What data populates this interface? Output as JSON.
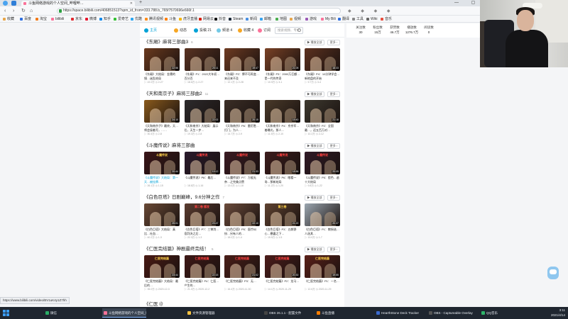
{
  "browser": {
    "tab_title": "斗鱼网络游戏的个人空间_哔哩哔…",
    "url": "https://space.bilibili.com/406851513?spm_id_from=333.788.b_765f7570696e666f.1",
    "nav": [
      "‹",
      "›",
      "↻",
      "⌂"
    ],
    "window_controls": "— ▢ ✕",
    "bookmarks": [
      {
        "label": "收藏",
        "color": "#e8a64a"
      },
      {
        "label": "百度",
        "color": "#2f6fe0"
      },
      {
        "label": "淘宝",
        "color": "#f27a1a"
      },
      {
        "label": "bilibili",
        "color": "#fb7299"
      },
      {
        "label": "京东",
        "color": "#e0282e"
      },
      {
        "label": "微博",
        "color": "#e6162d"
      },
      {
        "label": "知乎",
        "color": "#0f88eb"
      },
      {
        "label": "爱奇艺",
        "color": "#35c035"
      },
      {
        "label": "优酷",
        "color": "#2ca6f0"
      },
      {
        "label": "腾讯视频",
        "color": "#ff8c1a"
      },
      {
        "label": "斗鱼",
        "color": "#ff7e00"
      },
      {
        "label": "虎牙直播",
        "color": "#f7b500"
      },
      {
        "label": "网易云",
        "color": "#d81e06"
      },
      {
        "label": "抖音",
        "color": "#111111"
      },
      {
        "label": "Steam",
        "color": "#1b2838"
      },
      {
        "label": "新闻",
        "color": "#4a90e2"
      },
      {
        "label": "邮箱",
        "color": "#35a3f0"
      },
      {
        "label": "地图",
        "color": "#4caf50"
      },
      {
        "label": "视频",
        "color": "#e8a64a"
      },
      {
        "label": "游戏",
        "color": "#9b59b6"
      },
      {
        "label": "My Bili",
        "color": "#fb7299"
      },
      {
        "label": "翻译",
        "color": "#2f6fe0"
      },
      {
        "label": "工具",
        "color": "#888888"
      },
      {
        "label": "Wiki",
        "color": "#666666"
      },
      {
        "label": "音乐",
        "color": "#e74c3c"
      }
    ]
  },
  "subnav": {
    "items": [
      {
        "label": "主页",
        "color": "#00a1d6",
        "active": true
      },
      {
        "label": "动态",
        "color": "#f6a623"
      },
      {
        "label": "投稿 21",
        "color": "#00a1d6"
      },
      {
        "label": "频道 4",
        "color": "#73c9e5"
      },
      {
        "label": "收藏 4",
        "color": "#f6a623"
      },
      {
        "label": "订阅",
        "color": "#fb7299"
      }
    ],
    "search_placeholder": "搜索视频、专栏"
  },
  "stats": [
    {
      "label": "关注数",
      "value": "30"
    },
    {
      "label": "粉丝数",
      "value": "15万"
    },
    {
      "label": "获赞数",
      "value": "46.7万"
    },
    {
      "label": "播放数",
      "value": "1276.7万"
    },
    {
      "label": "阅读数",
      "value": "0"
    }
  ],
  "sections": [
    {
      "title": "《东厢》麻将三部曲3",
      "count": "6",
      "play_all": "▶ 播放全部",
      "more": "更多 ›",
      "cards": [
        {
          "title": "《东厢》大结局：金庸的镜…迷乱结局",
          "meta": "▷ 22.0万  ◷ 2-27",
          "dur": "22:56",
          "bg": "#6b3a1e",
          "cap": "",
          "capColor": "#ffd24a"
        },
        {
          "title": "《东厢》P1：2022大年初…百分百",
          "meta": "▷ 18.6万  ◷ 2-27",
          "dur": "20:11",
          "bg": "#5a3322",
          "cap": "",
          "capColor": "#ffd24a"
        },
        {
          "title": "《东厢》P2：牌不可再变…来还来不及",
          "meta": "▷ 12.1万  ◷ 2-28",
          "dur": "19:47",
          "bg": "#6e3b22",
          "cap": "",
          "capColor": "#ffd24a"
        },
        {
          "title": "《东厢》P3：2000万巨额…是一代的传奇",
          "meta": "▷ 10.9万  ◷ 3-1",
          "dur": "21:05",
          "bg": "#7a4226",
          "cap": "",
          "capColor": "#ffd24a"
        },
        {
          "title": "《东厢》P4：10分钟学会…新地盘的开始",
          "meta": "▷ 9.7万  ◷ 3-4",
          "dur": "18:33",
          "bg": "#5d3220",
          "cap": "",
          "capColor": "#ffd24a"
        }
      ]
    },
    {
      "title": "《天和南京子》麻将三部曲2",
      "count": "11",
      "play_all": "▶ 播放全部",
      "more": "更多 ›",
      "cards": [
        {
          "title": "《天和南京子》最终，天…将会接着写，……",
          "meta": "▷ 30.4万  ◷ 2-8",
          "dur": "24:10",
          "bg": "#8a5a1c",
          "cap": "",
          "capColor": "#ffd24a"
        },
        {
          "title": "《天和南京》大结局：展示后，天生一步…",
          "meta": "▷ 19.3万  ◷ 2-8",
          "dur": "22:02",
          "bg": "#2c2a2c",
          "cap": "",
          "capColor": "#ffd24a"
        },
        {
          "title": "《天和南京》P6：雷厉胜…打门，为人…",
          "meta": "▷ 14.7万  ◷ 2-9",
          "dur": "20:15",
          "bg": "#3b2e26",
          "cap": "",
          "capColor": "#ffd24a"
        },
        {
          "title": "《天和南京》P4：京京军…着曝光，那人…",
          "meta": "▷ 11.5万  ◷ 2-10",
          "dur": "19:40",
          "bg": "#4a3a2a",
          "cap": "",
          "capColor": "#ffd24a"
        },
        {
          "title": "《天和南京》P2：全国最…，还五百万对…",
          "meta": "▷ 10.2万  ◷ 2-12",
          "dur": "21:18",
          "bg": "#3e3a30",
          "cap": "",
          "capColor": "#ffd24a"
        }
      ]
    },
    {
      "title": "《斗魔传说》麻将三部曲",
      "count": "",
      "play_all": "▶ 播放全部",
      "more": "更多 ›",
      "cards": [
        {
          "title": "《斗魔传说》大结局：第一天…被挂牌…",
          "meta": "▷ 26.1万  ◷ 1-15",
          "dur": "20:44",
          "bg": "#3a1518",
          "cap": "斗魔传说",
          "capColor": "#ffd24a",
          "highlight": true
        },
        {
          "title": "《斗魔传说》P8：最后…",
          "meta": "▷ 18.8万  ◷ 1-16",
          "dur": "19:12",
          "bg": "#2a1a2c",
          "cap": "斗魔传说",
          "capColor": "#ff4040"
        },
        {
          "title": "《斗魔传说》P7：万般无奈…之完美点赞",
          "meta": "▷ 13.0万  ◷ 1-18",
          "dur": "21:33",
          "bg": "#3a1a22",
          "cap": "斗魔传说",
          "capColor": "#ff4040"
        },
        {
          "title": "《斗魔传说》P6：眼看一场…那新结局",
          "meta": "▷ 11.2万  ◷ 1-20",
          "dur": "18:56",
          "bg": "#3c1c1c",
          "cap": "斗魔传说",
          "capColor": "#ff4040"
        },
        {
          "title": "《斗魔传说》P5：脸色…逃十大结局",
          "meta": "▷ 9.8万  ◷ 1-22",
          "dur": "20:05",
          "bg": "#301a26",
          "cap": "斗魔传说",
          "capColor": "#ff4040"
        }
      ]
    },
    {
      "title": "《白色巨塔》日剧巅峰，9.6分神之作",
      "count": "7",
      "play_all": "▶ 播放全部",
      "more": "更多 ›",
      "cards": [
        {
          "title": "《白色巨塔》大结局：真比…吐血…",
          "meta": "▷ 40.2万  ◷ 1-3",
          "dur": "25:01",
          "bg": "#6a4a36",
          "cap": "",
          "capColor": "#ffd24a"
        },
        {
          "title": "《白色巨塔》P7：三审判…庭判决之后…",
          "meta": "▷ 22.3万  ◷ 1-3",
          "dur": "23:47",
          "bg": "#5a3c30",
          "cap": "第二卷 爆发",
          "capColor": "#ff4040"
        },
        {
          "title": "《白色巨塔》P5：医疗纠纷…另有人的…",
          "meta": "▷ 18.0万  ◷ 1-4",
          "dur": "22:10",
          "bg": "#6b4b3b",
          "cap": "",
          "capColor": "#ffd24a"
        },
        {
          "title": "《白色巨塔》P3：五郎野心…暴露之下…",
          "meta": "▷ 15.5万  ◷ 1-5",
          "dur": "21:22",
          "bg": "#5e4230",
          "cap": "第三卷",
          "capColor": "#ffd24a"
        },
        {
          "title": "《白色巨塔》P1：教授选…人选其…",
          "meta": "▷ 13.9万  ◷ 1-7",
          "dur": "20:37",
          "bg": "#9ba6b0",
          "cap": "",
          "capColor": "#ffd24a"
        }
      ]
    },
    {
      "title": "《仁医完结篇》神剧最终完结！",
      "count": "5",
      "play_all": "▶ 播放全部",
      "more": "更多 ›",
      "cards": [
        {
          "title": "《仁医完结篇》大结局：最后的…",
          "meta": "▷ 35.0万  ◷ 2020-12-3",
          "dur": "23:44",
          "bg": "#4a1a14",
          "cap": "仁医完结篇",
          "capColor": "#ffd24a"
        },
        {
          "title": "《仁医完结篇》P4：仁医…产生的…",
          "meta": "▷ 21.0万  ◷ 2020-12-2",
          "dur": "22:15",
          "bg": "#3e1816",
          "cap": "仁医完结篇",
          "capColor": "#ff4040"
        },
        {
          "title": "《仁医完结篇》P3：无…",
          "meta": "▷ 16.4万  ◷ 2020-11-30",
          "dur": "21:02",
          "bg": "#4a1e18",
          "cap": "仁医完结篇",
          "capColor": "#ff4040"
        },
        {
          "title": "《仁医完结篇》P2：龙马…",
          "meta": "▷ 14.1万  ◷ 2020-11-29",
          "dur": "20:30",
          "bg": "#4c1c1a",
          "cap": "仁医完结篇",
          "capColor": "#ff4040"
        },
        {
          "title": "《仁医完结篇》P1：一名…",
          "meta": "▷ 12.6万  ◷ 2020-11-29",
          "dur": "19:55",
          "bg": "#5a2018",
          "cap": "仁医完结篇",
          "capColor": "#ffd24a"
        }
      ]
    }
  ],
  "next_section_title": "《仁医 Ⅰ》",
  "status_url": "https://www.bilibili.com/video/BV1uK4y1Z7hh",
  "taskbar": {
    "items": [
      {
        "label": "微信",
        "color": "#2aae67"
      },
      {
        "label": "斗鱼网络游戏的个人空间_哔哩…",
        "color": "#fb7299",
        "active": true
      },
      {
        "label": "文件资源管理器",
        "color": "#f5c242"
      },
      {
        "label": "OBS 26.1.1 - 配置文件",
        "color": "#444444"
      },
      {
        "label": "斗鱼直播",
        "color": "#ff7e00"
      },
      {
        "label": "HearthStone Deck Tracker",
        "color": "#3b6bd1"
      },
      {
        "label": "OBS - Captureable Overlay",
        "color": "#555555"
      },
      {
        "label": "QQ音乐",
        "color": "#2fb56a"
      }
    ],
    "time": "3:11",
    "date": "2021/4/14"
  }
}
